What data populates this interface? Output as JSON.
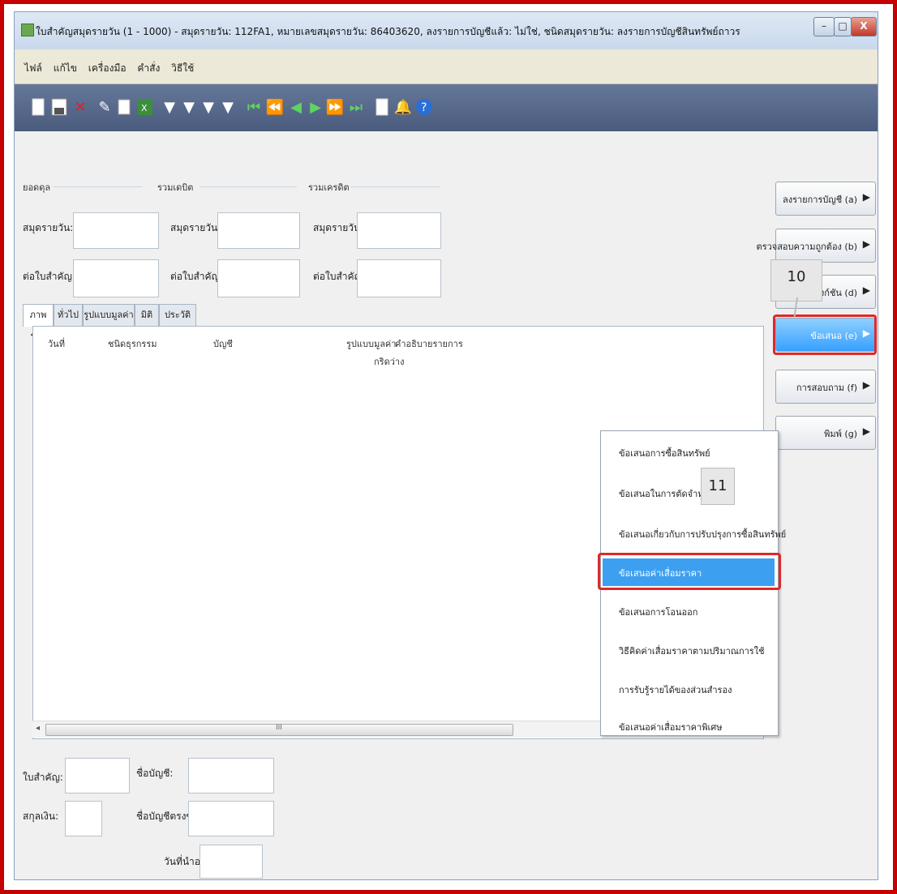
{
  "window": {
    "title": "ใบสำคัญสมุดรายวัน (1 - 1000) - สมุดรายวัน: 112FA1, หมายเลขสมุดรายวัน: 86403620, ลงรายการบัญชีแล้ว: ไม่ใช่, ชนิดสมุดรายวัน: ลงรายการบัญชีสินทรัพย์ถาวร",
    "min": "–",
    "max": "□",
    "close": "X"
  },
  "menu": [
    "ไฟล์",
    "แก้ไข",
    "เครื่องมือ",
    "คำสั่ง",
    "วิธีใช้"
  ],
  "toolbar_icons": [
    "new-doc-icon",
    "save-icon",
    "delete-icon",
    "edit-icon",
    "copy-icon",
    "excel-icon",
    "filter-icon",
    "filter-select-icon",
    "filter-advanced-icon",
    "filter-clear-icon",
    "first-icon",
    "prev-page-icon",
    "prev-icon",
    "next-icon",
    "next-page-icon",
    "last-icon",
    "document-icon",
    "alert-icon",
    "help-icon"
  ],
  "balances": {
    "group1": "ยอดดุล",
    "group2": "รวมเดบิต",
    "group3": "รวมเครดิต",
    "journal_label": "สมุดรายวัน:",
    "voucher_label": "ต่อใบสำคัญ:"
  },
  "tabs": [
    "ภาพรวม",
    "ทั่วไป",
    "รูปแบบมูลค่า",
    "มิติ",
    "ประวัติ"
  ],
  "grid": {
    "columns": [
      "วันที่",
      "ชนิดธุรกรรม",
      "บัญชี",
      "รูปแบบมูลค่า",
      "คำอธิบายรายการ"
    ],
    "empty": "กริดว่าง",
    "scroll_mark": "III"
  },
  "side_buttons": [
    "ลงรายการบัญชี (a)",
    "ตรวจสอบความถูกต้อง (b)",
    "ฟังก์ชัน (d)",
    "ข้อเสนอ (e)",
    "การสอบถาม (f)",
    "พิมพ์ (g)"
  ],
  "popup_menu": [
    "ข้อเสนอการซื้อสินทรัพย์",
    "ข้อเสนอในการตัดจำหน่ายเศษ",
    "ข้อเสนอเกี่ยวกับการปรับปรุงการซื้อสินทรัพย์",
    "ข้อเสนอค่าเสื่อมราคา",
    "ข้อเสนอการโอนออก",
    "วิธีคิดค่าเสื่อมราคาตามปริมาณการใช้",
    "การรับรู้รายได้ของส่วนสำรอง",
    "ข้อเสนอค่าเสื่อมราคาพิเศษ"
  ],
  "callouts": {
    "step10": "10",
    "step11": "11"
  },
  "bottom": {
    "voucher": "ใบสำคัญ:",
    "account": "ชื่อบัญชี:",
    "currency": "สกุลเงิน:",
    "offset_account": "ชื่อบัญชีตรงข้าม:",
    "due_date": "วันที่นำออกใช้:"
  },
  "colors": {
    "highlight": "#e02828",
    "selected": "#3d9ff0",
    "frame": "#c40000"
  }
}
